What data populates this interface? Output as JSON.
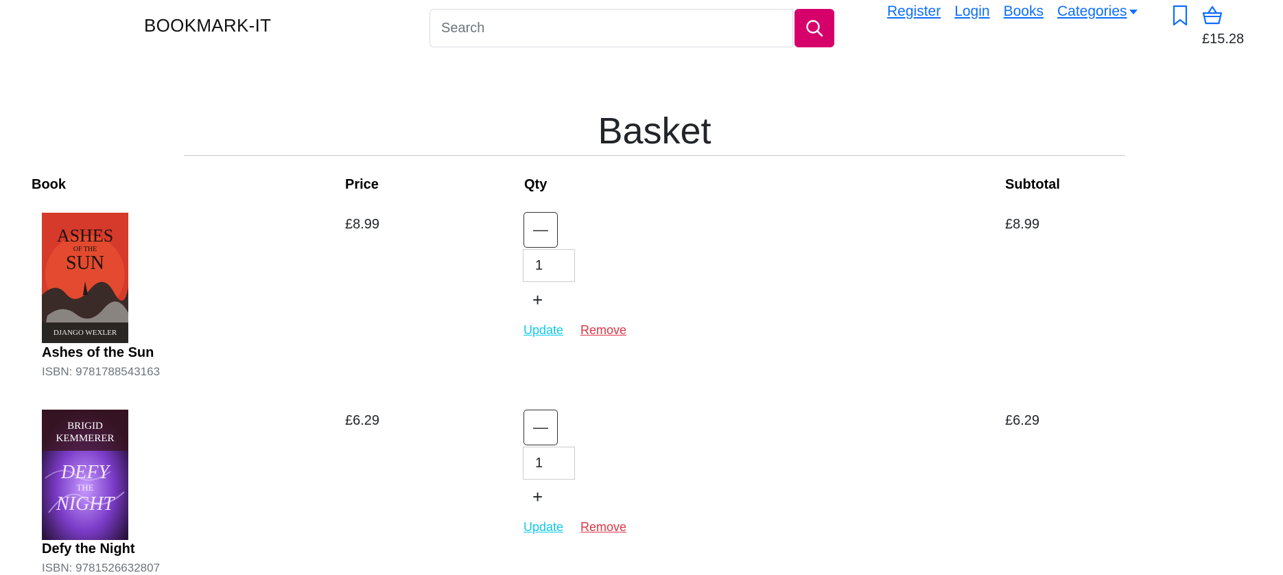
{
  "header": {
    "brand": "BOOKMARK-IT",
    "search_placeholder": "Search",
    "nav": {
      "register": "Register",
      "login": "Login",
      "books": "Books",
      "categories": "Categories"
    },
    "basket_total": "£15.28",
    "accent_color": "#d6006b",
    "link_color": "#0d6efd"
  },
  "page": {
    "title": "Basket"
  },
  "table": {
    "headers": {
      "book": "Book",
      "price": "Price",
      "qty": "Qty",
      "subtotal": "Subtotal"
    },
    "rows": [
      {
        "title": "Ashes of the Sun",
        "isbn": "ISBN: 9781788543163",
        "price": "£8.99",
        "qty": "1",
        "subtotal": "£8.99",
        "update": "Update",
        "remove": "Remove",
        "cover": {
          "line1": "ASHES",
          "line2": "OF THE",
          "line3": "SUN",
          "author": "DJANGO WEXLER"
        }
      },
      {
        "title": "Defy the Night",
        "isbn": "ISBN: 9781526632807",
        "price": "£6.29",
        "qty": "1",
        "subtotal": "£6.29",
        "update": "Update",
        "remove": "Remove",
        "cover": {
          "author1": "BRIGID",
          "author2": "KEMMERER",
          "line1": "DEFY",
          "line2": "THE",
          "line3": "NIGHT"
        }
      }
    ]
  },
  "icons": {
    "search": "search-icon",
    "bookmark": "bookmark-icon",
    "basket": "basket-icon",
    "minus": "—",
    "plus": "+"
  }
}
